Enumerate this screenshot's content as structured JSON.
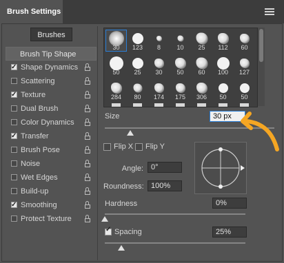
{
  "panel": {
    "tab_title": "Brush Settings",
    "menu_icon": "hamburger-menu-icon"
  },
  "brushes_button": "Brushes",
  "left_list": {
    "header": "Brush Tip Shape",
    "items": [
      {
        "label": "Shape Dynamics",
        "checked": true
      },
      {
        "label": "Scattering",
        "checked": false
      },
      {
        "label": "Texture",
        "checked": true
      },
      {
        "label": "Dual Brush",
        "checked": false
      },
      {
        "label": "Color Dynamics",
        "checked": false
      },
      {
        "label": "Transfer",
        "checked": true
      },
      {
        "label": "Brush Pose",
        "checked": false
      },
      {
        "label": "Noise",
        "checked": false
      },
      {
        "label": "Wet Edges",
        "checked": false
      },
      {
        "label": "Build-up",
        "checked": false
      },
      {
        "label": "Smoothing",
        "checked": true
      },
      {
        "label": "Protect Texture",
        "checked": false
      }
    ]
  },
  "presets": {
    "selected_index": 0,
    "row1": [
      "30",
      "123",
      "8",
      "10",
      "25",
      "112",
      "60"
    ],
    "row2": [
      "50",
      "25",
      "30",
      "50",
      "60",
      "100",
      "127"
    ],
    "row3": [
      "284",
      "80",
      "174",
      "175",
      "306",
      "50",
      "50"
    ]
  },
  "tip_shape": {
    "size_label": "Size",
    "size_value": "30 px",
    "size_fraction": 0.15,
    "flip_x_label": "Flip X",
    "flip_y_label": "Flip Y",
    "flip_x_checked": false,
    "flip_y_checked": false,
    "angle_label": "Angle:",
    "angle_value": "0°",
    "roundness_label": "Roundness:",
    "roundness_value": "100%",
    "hardness_label": "Hardness",
    "hardness_value": "0%",
    "hardness_fraction": 0.0,
    "spacing_label": "Spacing",
    "spacing_checked": true,
    "spacing_value": "25%",
    "spacing_fraction": 0.12
  },
  "annotation": {
    "arrow_color": "#f5a623",
    "arrow_icon": "curved-arrow-icon"
  },
  "colors": {
    "panel_bg": "#535353",
    "accent": "#2a7fd8"
  }
}
